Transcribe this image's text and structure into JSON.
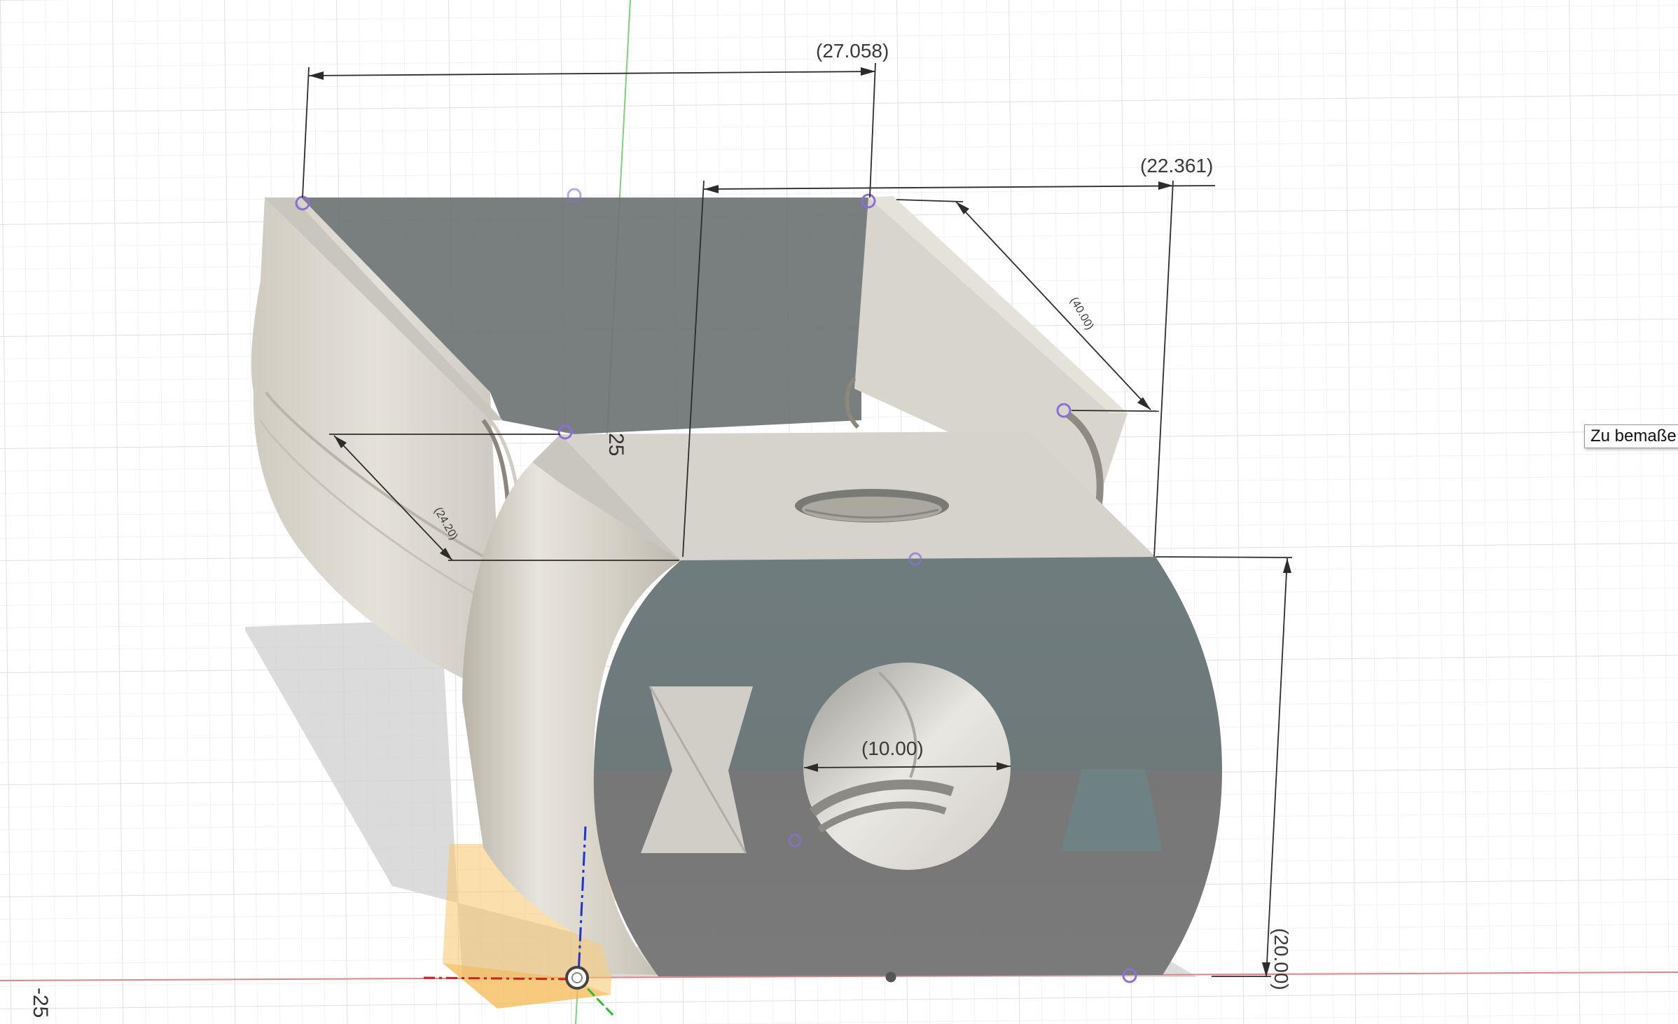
{
  "dimensions": {
    "top_width": "(27.058)",
    "right_width": "(22.361)",
    "diagonal_right": "(40.00)",
    "diagonal_left": "(24.20)",
    "hole_diameter": "(10.00)",
    "height": "(20.00)"
  },
  "axis_labels": {
    "y_tick": "25",
    "x_tick": "-25"
  },
  "tooltip": {
    "text": "Zu bemaße"
  },
  "colors": {
    "grid": "#e6e8ea",
    "grid_major": "#d6d9dc",
    "x_axis": "#d9868a",
    "y_axis": "#7fcf7f",
    "z_axis": "#2233cc",
    "body_light": "#d8d5cc",
    "body_face": "#6f7a7b",
    "sketch_point": "#8a6fd6",
    "shadow": "#c9c9c9",
    "orange_plane": "#f7c46a"
  },
  "icons": {
    "origin": "origin-point-icon"
  }
}
